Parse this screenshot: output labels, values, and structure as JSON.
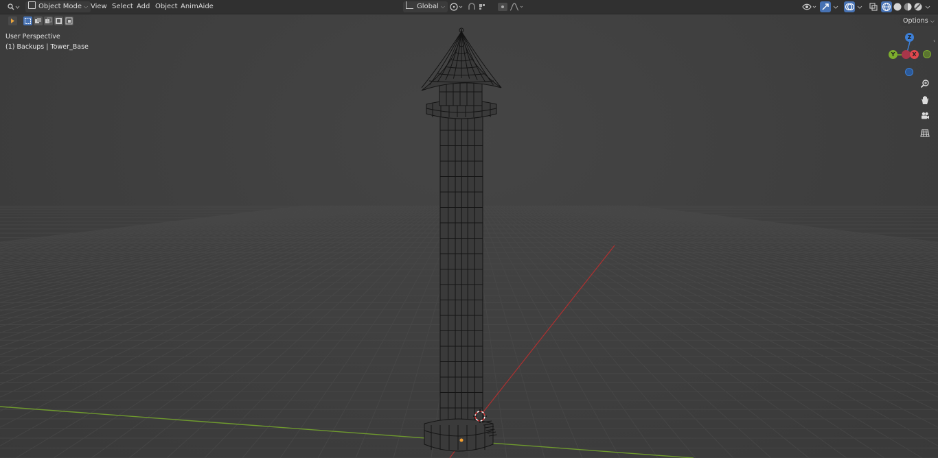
{
  "header": {
    "mode_label": "Object Mode",
    "menus": [
      "View",
      "Select",
      "Add",
      "Object",
      "AnimAide"
    ],
    "transform_orientation": "Global",
    "options_label": "Options"
  },
  "viewport": {
    "view_name": "User Perspective",
    "collection_object": "(1) Backups | Tower_Base",
    "background_color": "#3d3d3d",
    "grid_color": "#4a4a4a",
    "x_axis_color": "#b03030",
    "y_axis_color": "#6f9a2e",
    "wire_color": "#141414"
  },
  "gizmo": {
    "z_label": "Z",
    "y_label": "Y",
    "x_label": "X",
    "x_color": "#e0484e",
    "y_color": "#7dae2d",
    "z_color": "#3d7fd6"
  },
  "icons": {
    "editor_type": "editor-type-icon",
    "mode": "object-mode-icon",
    "pivot": "transform-pivot-icon",
    "snap": "snap-icon",
    "proportional": "proportional-edit-icon",
    "visibility": "visibility-icon",
    "gizmo_toggle": "gizmo-toggle-icon",
    "overlays": "overlays-icon",
    "xray": "xray-icon",
    "shading": [
      "wireframe-shading-icon",
      "solid-shading-icon",
      "material-shading-icon",
      "rendered-shading-icon"
    ],
    "nav": [
      "zoom-icon",
      "pan-hand-icon",
      "camera-view-icon",
      "ortho-grid-icon"
    ]
  }
}
